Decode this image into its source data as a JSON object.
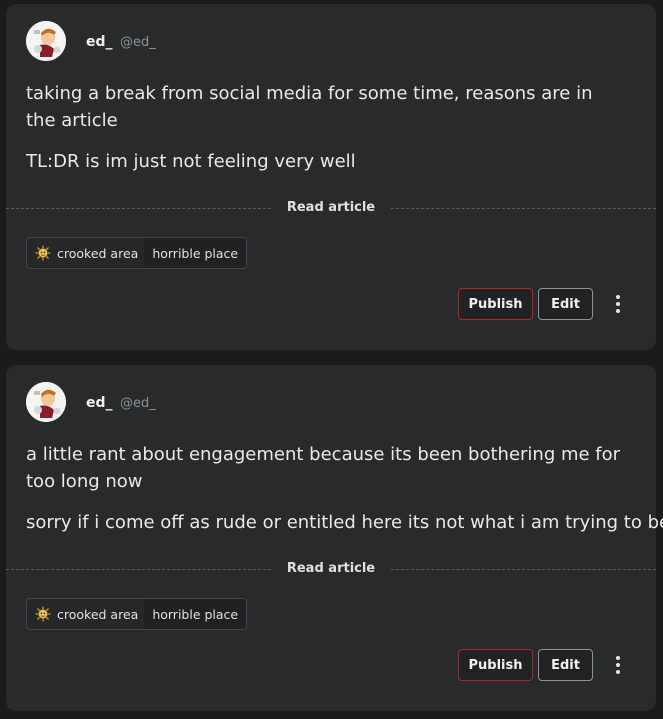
{
  "posts": [
    {
      "author": {
        "name": "ed_",
        "handle": "@ed_"
      },
      "title": "taking a break from social media for some time, reasons are in the article",
      "subtitle": "TL:DR is im just not feeling very well",
      "read_label": "Read article",
      "tags": [
        "crooked area",
        "horrible place"
      ],
      "actions": {
        "publish": "Publish",
        "edit": "Edit"
      }
    },
    {
      "author": {
        "name": "ed_",
        "handle": "@ed_"
      },
      "title": "a little rant about engagement because its been bothering me for too long now",
      "subtitle": "sorry if i come off as rude or entitled here its not what i am trying to be",
      "read_label": "Read article",
      "tags": [
        "crooked area",
        "horrible place"
      ],
      "actions": {
        "publish": "Publish",
        "edit": "Edit"
      }
    }
  ],
  "icons": {
    "avatar": "character-avatar",
    "tag": "sun-face-icon",
    "more": "more-vertical-icon"
  },
  "colors": {
    "background": "#1a1b1c",
    "card": "#282a2b",
    "publish_border": "#a8282b",
    "edit_border": "#8f9295"
  }
}
